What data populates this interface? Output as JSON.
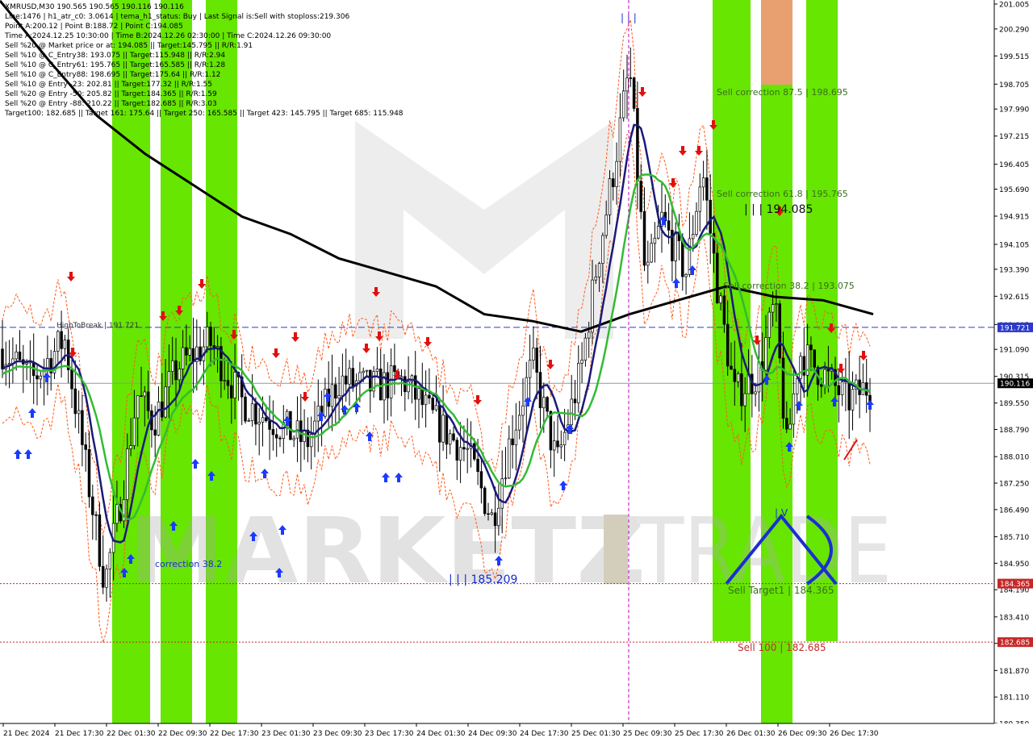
{
  "chart_data": {
    "type": "candlestick",
    "symbol": "XMRUSD,M30",
    "ohlc_header": "XMRUSD,M30  190.565 190.565 190.116 190.116",
    "y_ticks": [
      "201.005",
      "200.290",
      "199.515",
      "198.705",
      "197.990",
      "197.215",
      "196.405",
      "195.690",
      "194.915",
      "194.105",
      "193.390",
      "192.615",
      "191.805",
      "191.090",
      "190.315",
      "189.550",
      "188.790",
      "188.010",
      "187.250",
      "186.490",
      "185.710",
      "184.950",
      "184.190",
      "183.410",
      "182.650",
      "181.870",
      "181.110",
      "180.350"
    ],
    "ylim": [
      180.35,
      201.005
    ],
    "x_ticks": [
      "21 Dec 2024",
      "21 Dec 17:30",
      "22 Dec 01:30",
      "22 Dec 09:30",
      "22 Dec 17:30",
      "23 Dec 01:30",
      "23 Dec 09:30",
      "23 Dec 17:30",
      "24 Dec 01:30",
      "24 Dec 09:30",
      "24 Dec 17:30",
      "25 Dec 01:30",
      "25 Dec 09:30",
      "25 Dec 17:30",
      "26 Dec 01:30",
      "26 Dec 09:30",
      "26 Dec 17:30"
    ],
    "price_labels": [
      {
        "text": "191.721",
        "value": 191.721,
        "color": "#2d3ac8"
      },
      {
        "text": "190.116",
        "value": 190.116,
        "color": "#000000"
      },
      {
        "text": "184.365",
        "value": 184.365,
        "color": "#c62828"
      },
      {
        "text": "182.685",
        "value": 182.685,
        "color": "#c62828"
      }
    ],
    "horizontal_lines": [
      {
        "value": 191.721,
        "style": "dashed",
        "color": "#2d3ac8"
      },
      {
        "value": 190.116,
        "style": "solid",
        "color": "#8899aa"
      },
      {
        "value": 184.365,
        "style": "dotted",
        "color": "#c62828"
      },
      {
        "value": 182.685,
        "style": "dotted",
        "color": "#c62828"
      }
    ],
    "annotations": [
      {
        "text": "Sell correction 87.5 | 198.695",
        "color": "#3a6e1e"
      },
      {
        "text": "Sell correction 61.8 | 195.765",
        "color": "#3a6e1e"
      },
      {
        "text": "| | | 194.085",
        "color": "#111111"
      },
      {
        "text": "Sell correction 38.2 | 193.075",
        "color": "#3a6e1e"
      },
      {
        "text": "Sell Target1 | 184.365",
        "color": "#3a6e1e"
      },
      {
        "text": "Sell 100 | 182.685",
        "color": "#c62828"
      },
      {
        "text": "| | | 185.209",
        "color": "#1a2fd0"
      },
      {
        "text": "correction 38.2",
        "color": "#1a2fd0"
      },
      {
        "text": "| | |",
        "color": "#1a2fd0"
      },
      {
        "text": "HighToBreak | 191.721",
        "color": "#333333"
      },
      {
        "text": "| V",
        "color": "#1a2fd0"
      }
    ],
    "series": [
      {
        "name": "MA slow",
        "color": "#000000"
      },
      {
        "name": "MA fast",
        "color": "#1a1a7a"
      },
      {
        "name": "MA green",
        "color": "#33bb33"
      }
    ],
    "watermark": "MARKETZITRADE"
  },
  "info_lines": [
    "XMRUSD,M30  190.565 190.565 190.116 190.116",
    "Line:1476 | h1_atr_c0: 3.0614 | tema_h1_status: Buy | Last Signal is:Sell with stoploss:219.306",
    "Point A:200.12 | Point B:188.72 | Point C:194.085",
    "Time A:2024.12.25 10:30:00 | Time B:2024.12.26 02:30:00 | Time C:2024.12.26 09:30:00",
    "Sell %20 @ Market price or at: 194.085 || Target:145.795 || R/R:1.91",
    "Sell %10 @ C_Entry38: 193.075 || Target:115.948 || R/R:2.94",
    "Sell %10 @ C_Entry61: 195.765 || Target:165.585 || R/R:1.28",
    "Sell %10 @ C_Entry88: 198.695 || Target:175.64 || R/R:1.12",
    "Sell %10 @ Entry -23: 202.81 || Target:177.32 || R/R:1.55",
    "Sell %20 @ Entry -50: 205.82 || Target:184.365 || R/R:1.59",
    "Sell %20 @ Entry -88: 210.22 || Target:182.685 || R/R:3.03",
    "Target100: 182.685 || Target 161: 175.64 || Target 250: 165.585 || Target 423: 145.795 || Target 685: 115.948"
  ],
  "colors": {
    "zone_green": "#66e600",
    "zone_orange": "#e8a070",
    "bull_candle": "#ffffff",
    "bear_candle": "#000000",
    "buy_arrow": "#1a3aff",
    "sell_arrow": "#e01010"
  }
}
